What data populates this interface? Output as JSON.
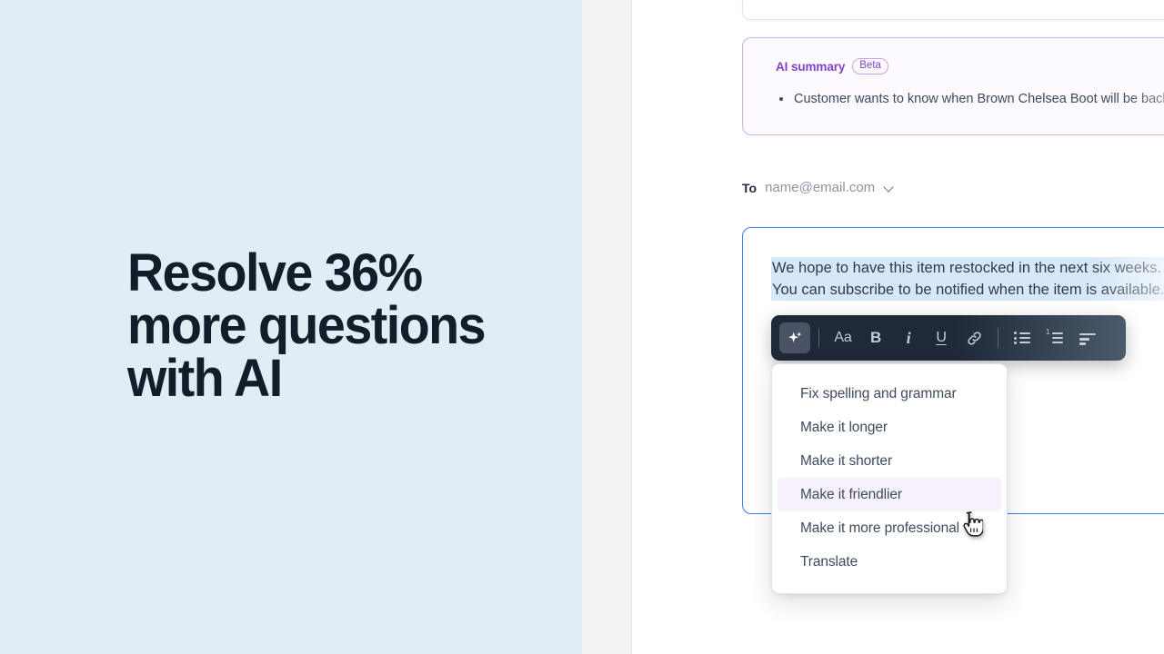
{
  "hero": {
    "headline": "Resolve 36% more questions with AI",
    "headline_lines": [
      "Resolve 36%",
      "more questions",
      "with AI"
    ],
    "background_color": "#e1ecf4",
    "text_color": "#121c2b"
  },
  "ai_summary": {
    "title": "AI summary",
    "badge": "Beta",
    "accent_color": "#8244c4",
    "bullets": [
      "Customer wants to know when Brown Chelsea Boot will be back in stock"
    ]
  },
  "compose": {
    "to_label": "To",
    "to_value": "name@email.com",
    "to_chevron_icon": "chevron-down-icon",
    "selected_text_lines": [
      "We hope to have this item restocked in the next six weeks.",
      "You can subscribe to be notified when the item is available."
    ],
    "selection_highlight_color": "#d6e7f8",
    "focus_border_color": "#3b82f6"
  },
  "toolbar": {
    "background_color": "#1f2937",
    "items": [
      {
        "name": "ai-assist-button",
        "icon": "sparkle-icon",
        "label": "",
        "active": true
      },
      {
        "name": "text-style-button",
        "icon": "text-style-icon",
        "label": "Aa",
        "active": false
      },
      {
        "name": "bold-button",
        "icon": "bold-icon",
        "label": "B",
        "active": false
      },
      {
        "name": "italic-button",
        "icon": "italic-icon",
        "label": "i",
        "active": false
      },
      {
        "name": "underline-button",
        "icon": "underline-icon",
        "label": "U",
        "active": false
      },
      {
        "name": "link-button",
        "icon": "link-icon",
        "label": "",
        "active": false
      },
      {
        "name": "bulleted-list-button",
        "icon": "bulleted-list-icon",
        "label": "",
        "active": false
      },
      {
        "name": "numbered-list-button",
        "icon": "numbered-list-icon",
        "label": "1",
        "active": false
      },
      {
        "name": "align-button",
        "icon": "align-left-icon",
        "label": "",
        "active": false
      }
    ]
  },
  "ai_menu": {
    "items": [
      {
        "label": "Fix spelling and grammar",
        "hovered": false
      },
      {
        "label": "Make it longer",
        "hovered": false
      },
      {
        "label": "Make it shorter",
        "hovered": false
      },
      {
        "label": "Make it friendlier",
        "hovered": true
      },
      {
        "label": "Make it more professional",
        "hovered": false
      },
      {
        "label": "Translate",
        "hovered": false
      }
    ],
    "hover_color": "#f6f1fb"
  },
  "cursor": {
    "icon": "pointing-hand-cursor"
  }
}
